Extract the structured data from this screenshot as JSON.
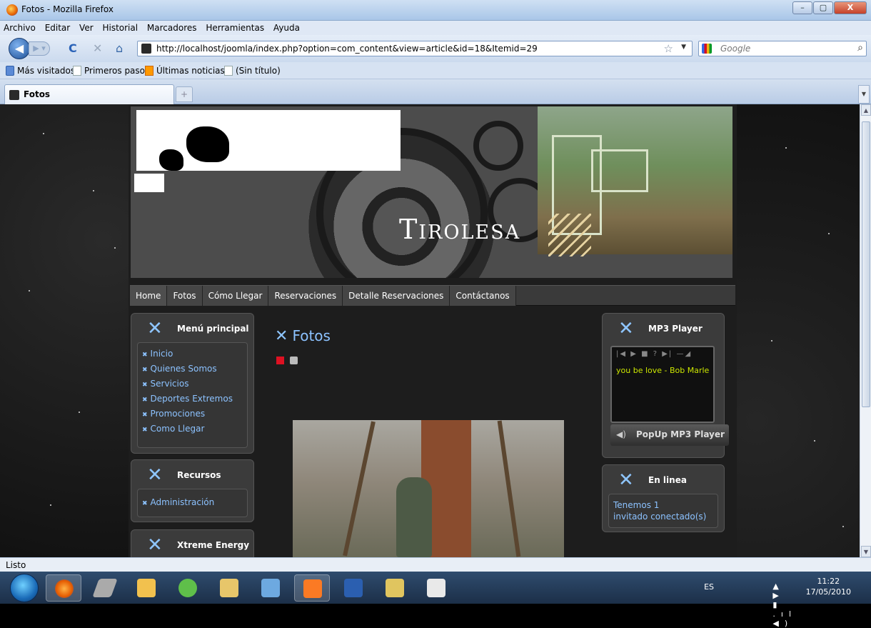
{
  "window": {
    "title": "Fotos - Mozilla Firefox",
    "controls": [
      "–",
      "▢",
      "X"
    ]
  },
  "menubar": [
    "Archivo",
    "Editar",
    "Ver",
    "Historial",
    "Marcadores",
    "Herramientas",
    "Ayuda"
  ],
  "nav": {
    "url": "http://localhost/joomla/index.php?option=com_content&view=article&id=18&Itemid=29",
    "search_placeholder": "Google"
  },
  "bookmarks": [
    "Más visitados",
    "Primeros pasos",
    "Últimas noticias",
    "(Sin título)"
  ],
  "tabs": [
    {
      "label": "Fotos"
    }
  ],
  "site": {
    "banner_title": "Tirolesa",
    "menu": [
      "Home",
      "Fotos",
      "Cómo Llegar",
      "Reservaciones",
      "Detalle Reservaciones",
      "Contáctanos"
    ],
    "left_modules": [
      {
        "title": "Menú principal",
        "items": [
          "Inicio",
          "Quienes Somos",
          "Servicios",
          "Deportes Extremos",
          "Promociones",
          "Como Llegar"
        ]
      },
      {
        "title": "Recursos",
        "items": [
          "Administración"
        ]
      },
      {
        "title": "Xtreme Energy",
        "items": []
      }
    ],
    "article_title": "Fotos",
    "mp3": {
      "title": "MP3 Player",
      "controls": "|◀ ▶ ■ ? ▶| —◢",
      "song": "you be love - Bob Marle",
      "popup_label": "PopUp MP3 Player"
    },
    "online": {
      "title": "En linea",
      "line1": "Tenemos 1",
      "line2": "invitado conectado(s)"
    }
  },
  "status": "Listo",
  "taskbar": {
    "lang": "ES",
    "tray_icons": "▲ ▶ ▮ .ıl ◀)",
    "time": "11:22",
    "date": "17/05/2010"
  },
  "colors": {
    "link": "#8cc2ff",
    "song": "#cce600",
    "background": "#121212"
  }
}
